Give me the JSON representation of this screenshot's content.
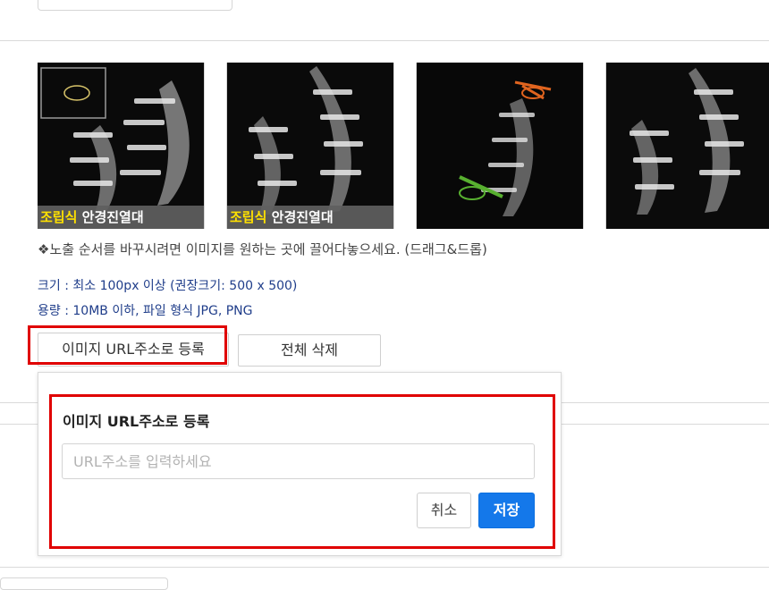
{
  "gallery": {
    "thumbnails": [
      {
        "caption_highlight": "조립식",
        "caption_text": "안경진열대",
        "icon": "acrylic-glasses-stand"
      },
      {
        "caption_highlight": "조립식",
        "caption_text": "안경진열대",
        "icon": "acrylic-glasses-stand"
      },
      {
        "caption_highlight": "",
        "caption_text": "",
        "icon": "acrylic-glasses-stand-with-glasses"
      },
      {
        "caption_highlight": "",
        "caption_text": "",
        "icon": "acrylic-glasses-stand"
      }
    ],
    "reorder_hint": "❖노출 순서를 바꾸시려면 이미지를 원하는 곳에 끌어다놓으세요. (드래그&드롭)"
  },
  "requirements": {
    "size": "크기 : 최소 100px 이상 (권장크기: 500 x 500)",
    "capacity": "용량 : 10MB 이하, 파일 형식 JPG, PNG"
  },
  "actions": {
    "register_url_label": "이미지 URL주소로 등록",
    "delete_all_label": "전체 삭제"
  },
  "url_popup": {
    "title": "이미지 URL주소로 등록",
    "input_value": "",
    "input_placeholder": "URL주소를 입력하세요",
    "cancel_label": "취소",
    "save_label": "저장"
  },
  "colors": {
    "highlight_border": "#e00000",
    "save_button": "#1478ea",
    "caption_highlight": "#ffe000",
    "info_text": "#1f3d8a"
  }
}
